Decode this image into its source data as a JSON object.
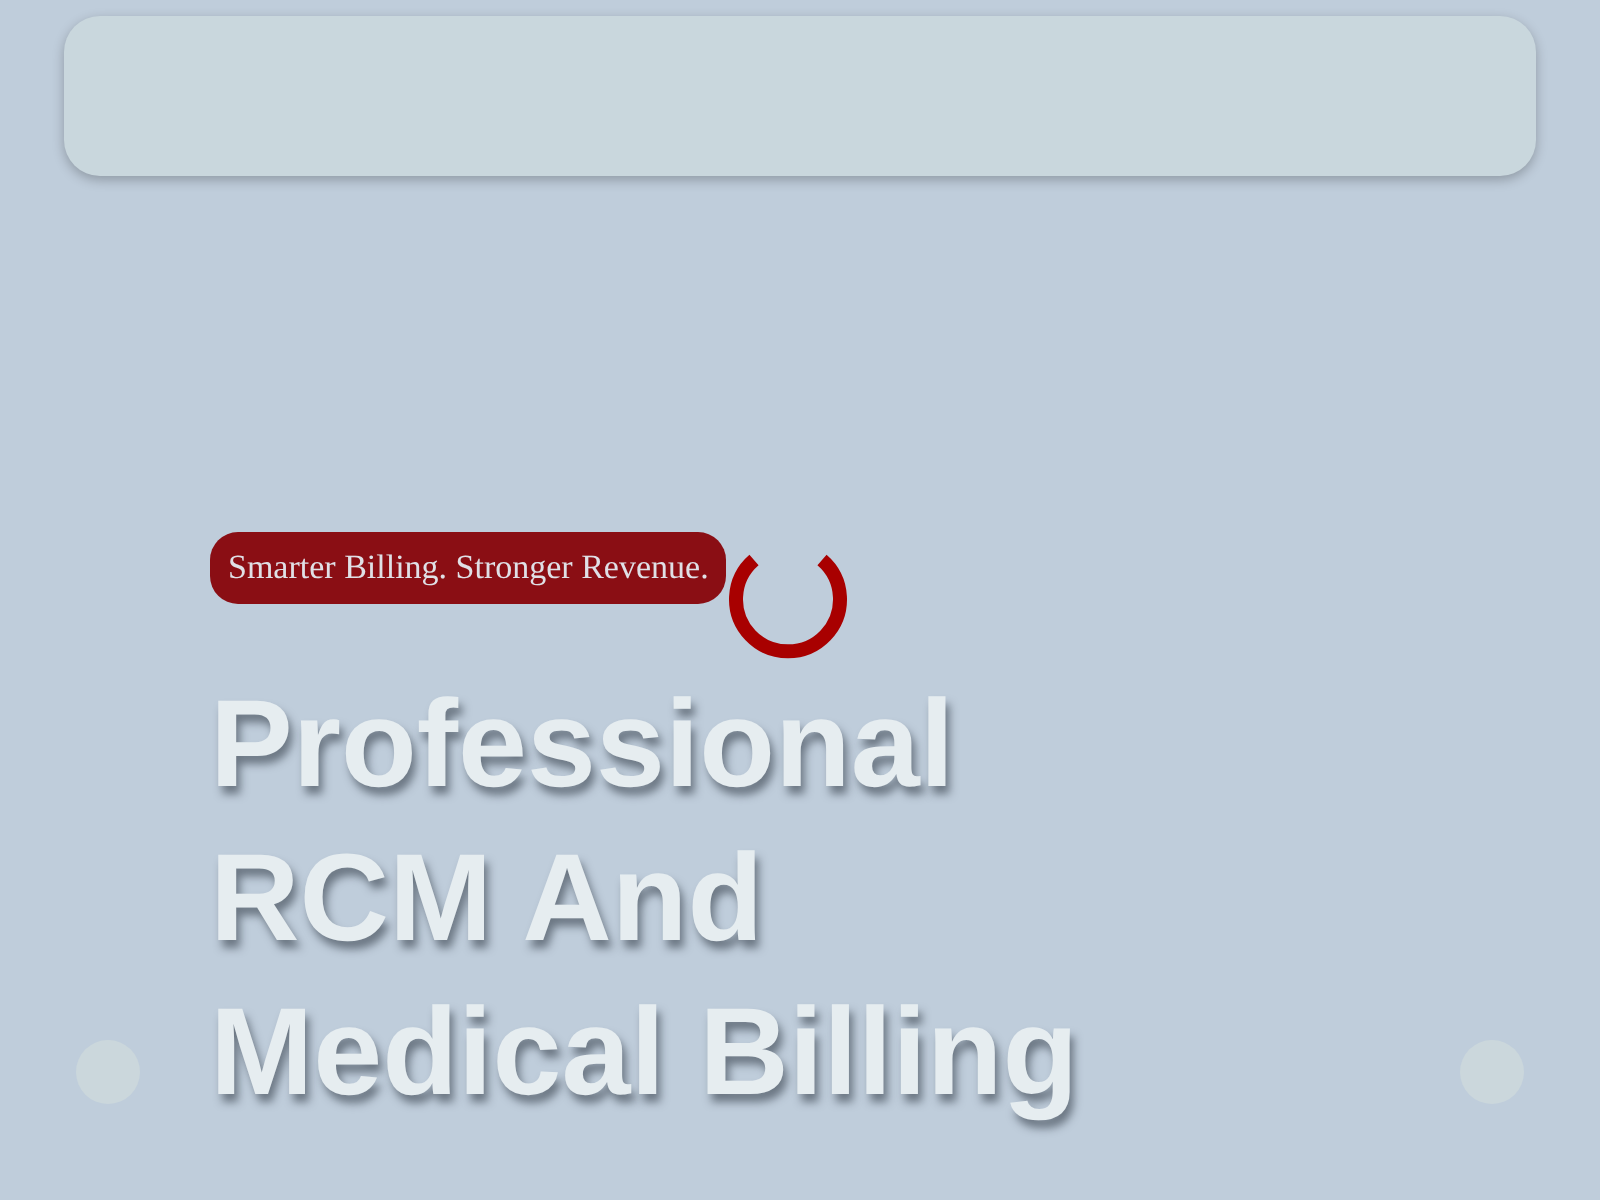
{
  "badge": "Smarter Billing. Stronger Revenue.",
  "heading": "Professional RCM And Medical Billing"
}
